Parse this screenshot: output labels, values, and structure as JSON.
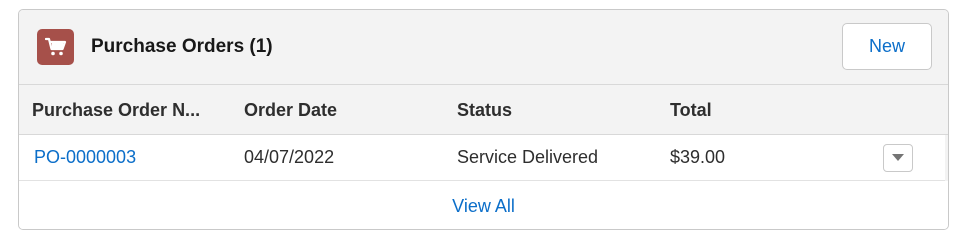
{
  "card": {
    "title": "Purchase Orders (1)",
    "icon": "cart-icon",
    "icon_color": "#a6504a",
    "new_button_label": "New"
  },
  "table": {
    "columns": [
      "Purchase Order N...",
      "Order Date",
      "Status",
      "Total"
    ],
    "rows": [
      {
        "purchase_order_number": "PO-0000003",
        "order_date": "04/07/2022",
        "status": "Service Delivered",
        "total": "$39.00",
        "menu_icon": "chevron-down-icon"
      }
    ]
  },
  "footer": {
    "view_all_label": "View All"
  },
  "colors": {
    "link": "#0b6ec9",
    "header_bg": "#f3f3f3",
    "border": "#c9c9c9"
  }
}
